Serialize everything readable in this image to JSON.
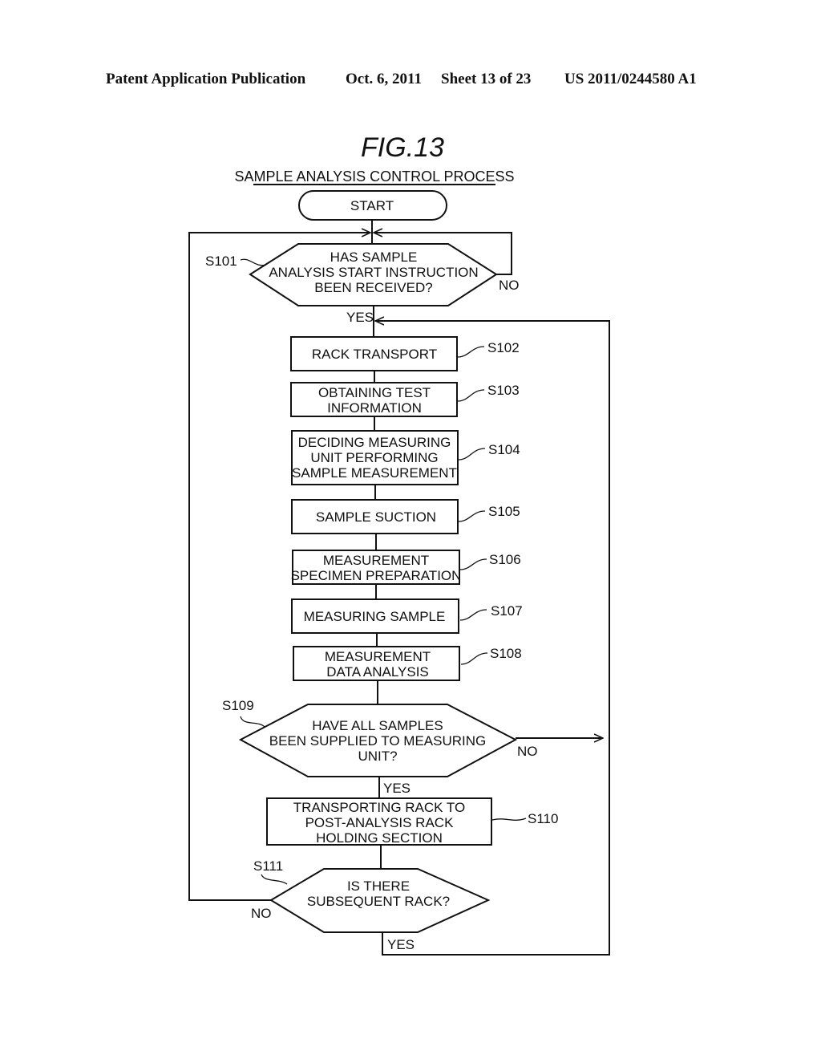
{
  "header": {
    "publication": "Patent Application Publication",
    "date": "Oct. 6, 2011",
    "sheet": "Sheet 13 of 23",
    "number": "US 2011/0244580 A1"
  },
  "figure": {
    "title": "FIG.13",
    "subtitle": "SAMPLE ANALYSIS CONTROL PROCESS"
  },
  "nodes": {
    "start": {
      "lines": [
        "START"
      ]
    },
    "s101": {
      "step": "S101",
      "lines": [
        "HAS SAMPLE",
        "ANALYSIS START INSTRUCTION",
        "BEEN RECEIVED?"
      ]
    },
    "s102": {
      "step": "S102",
      "lines": [
        "RACK TRANSPORT"
      ]
    },
    "s103": {
      "step": "S103",
      "lines": [
        "OBTAINING TEST",
        "INFORMATION"
      ]
    },
    "s104": {
      "step": "S104",
      "lines": [
        "DECIDING MEASURING",
        "UNIT PERFORMING",
        "SAMPLE MEASUREMENT"
      ]
    },
    "s105": {
      "step": "S105",
      "lines": [
        "SAMPLE SUCTION"
      ]
    },
    "s106": {
      "step": "S106",
      "lines": [
        "MEASUREMENT",
        "SPECIMEN PREPARATION"
      ]
    },
    "s107": {
      "step": "S107",
      "lines": [
        "MEASURING SAMPLE"
      ]
    },
    "s108": {
      "step": "S108",
      "lines": [
        "MEASUREMENT",
        "DATA ANALYSIS"
      ]
    },
    "s109": {
      "step": "S109",
      "lines": [
        "HAVE ALL SAMPLES",
        "BEEN SUPPLIED TO MEASURING",
        "UNIT?"
      ]
    },
    "s110": {
      "step": "S110",
      "lines": [
        "TRANSPORTING RACK TO",
        "POST-ANALYSIS RACK",
        "HOLDING SECTION"
      ]
    },
    "s111": {
      "step": "S111",
      "lines": [
        "IS THERE",
        "SUBSEQUENT RACK?"
      ]
    }
  },
  "edge_labels": {
    "s101_yes": "YES",
    "s101_no": "NO",
    "s109_yes": "YES",
    "s109_no": "NO",
    "s111_yes": "YES",
    "s111_no": "NO"
  }
}
